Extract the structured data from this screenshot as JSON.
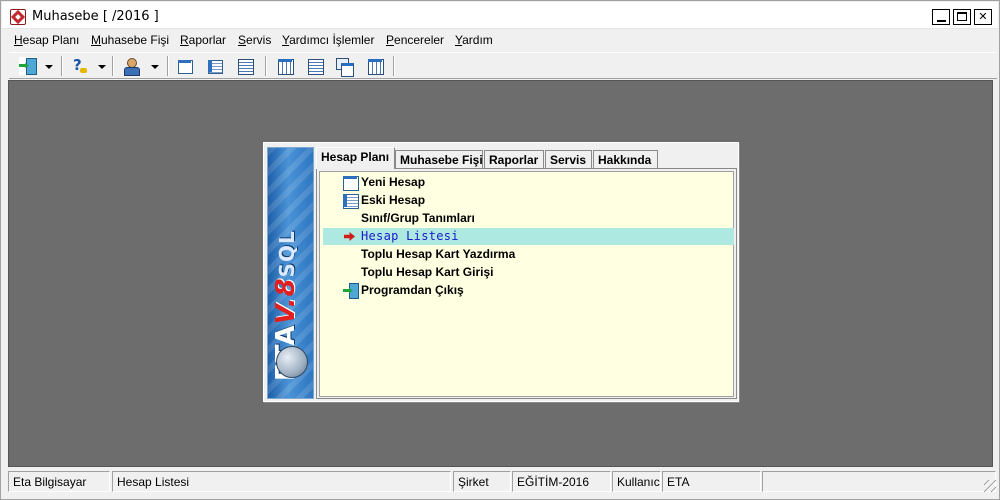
{
  "window": {
    "title": "Muhasebe [ /2016 ]",
    "controls": {
      "minimize": "minimize",
      "maximize": "maximize",
      "close": "close"
    }
  },
  "menubar": {
    "items": [
      {
        "label": "Hesap Planı",
        "mnemonic": "H",
        "rest": "esap Planı"
      },
      {
        "label": "Muhasebe Fişi",
        "mnemonic": "M",
        "rest": "uhasebe Fişi"
      },
      {
        "label": "Raporlar",
        "mnemonic": "R",
        "rest": "aporlar"
      },
      {
        "label": "Servis",
        "mnemonic": "S",
        "rest": "ervis"
      },
      {
        "label": "Yardımcı İşlemler",
        "mnemonic": "Y",
        "rest": "ardımcı İşlemler"
      },
      {
        "label": "Pencereler",
        "mnemonic": "P",
        "rest": "encereler"
      },
      {
        "label": "Yardım",
        "mnemonic": "Y",
        "rest": "ardım"
      }
    ]
  },
  "toolbar": {
    "buttons": [
      "exit-icon",
      "help-icon",
      "user-icon",
      "window-icon",
      "list-window-icon",
      "detail-list-icon",
      "grid-icon",
      "grid-columns-icon",
      "cascade-icon",
      "table-icon"
    ]
  },
  "dialog": {
    "brand": {
      "prefix": "ETA",
      "version": "V.8",
      "suffix": "SQL"
    },
    "tabs": [
      "Hesap Planı",
      "Muhasebe Fişi",
      "Raporlar",
      "Servis",
      "Hakkında"
    ],
    "active_tab": "Hesap Planı",
    "options": [
      {
        "label": "Yeni Hesap",
        "icon": "window-icon"
      },
      {
        "label": "Eski Hesap",
        "icon": "list-window-icon"
      },
      {
        "label": "Sınıf/Grup Tanımları",
        "icon": ""
      },
      {
        "label": "Hesap Listesi",
        "icon": "arrow-right-icon"
      },
      {
        "label": "Toplu Hesap Kart Yazdırma",
        "icon": ""
      },
      {
        "label": "Toplu Hesap Kart Girişi",
        "icon": ""
      },
      {
        "label": "Programdan Çıkış",
        "icon": "exit-icon"
      }
    ],
    "selected_option": "Hesap Listesi"
  },
  "statusbar": {
    "company_name": "Eta Bilgisayar",
    "current_screen": "Hesap Listesi",
    "company_label": "Şirket",
    "company_value": "EĞİTİM-2016",
    "user_label": "Kullanıcı",
    "user_value": "ETA"
  },
  "colors": {
    "workspace": "#6d6d6d",
    "panel_background": "#ffffe1",
    "selection": "#aee9e1",
    "selected_text": "#1a1acc",
    "arrow": "#d21d1d"
  }
}
